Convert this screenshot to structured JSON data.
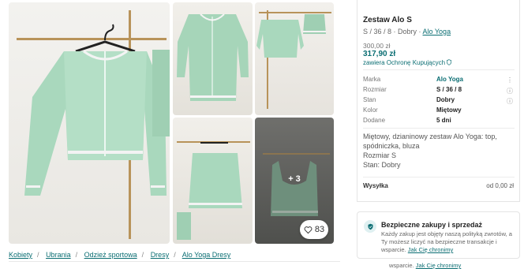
{
  "gallery": {
    "more_count": "+ 3",
    "likes": "83"
  },
  "breadcrumb": [
    "Kobiety",
    "Ubrania",
    "Odzież sportowa",
    "Dresy",
    "Alo Yoga Dresy"
  ],
  "listing": {
    "title": "Zestaw Alo S",
    "subtitle_prefix": "S / 36 / 8 · Dobry · ",
    "brand_link": "Alo Yoga",
    "price_old": "300,00 zł",
    "price_new": "317,90 zł",
    "protection": "zawiera Ochronę Kupujących"
  },
  "details": [
    {
      "key": "Marka",
      "value": "Alo Yoga",
      "link": true,
      "icon": "more-icon"
    },
    {
      "key": "Rozmiar",
      "value": "S / 36 / 8",
      "link": false,
      "icon": "info-icon"
    },
    {
      "key": "Stan",
      "value": "Dobry",
      "link": false,
      "icon": "info-icon"
    },
    {
      "key": "Kolor",
      "value": "Miętowy",
      "link": false,
      "icon": ""
    },
    {
      "key": "Dodane",
      "value": "5 dni",
      "link": false,
      "icon": ""
    }
  ],
  "description": {
    "line1": "Miętowy, dzianinowy zestaw Alo Yoga: top, spódniczka, bluza",
    "line2": "Rozmiar S",
    "line3": "Stan: Dobry"
  },
  "shipping": {
    "label": "Wysyłka",
    "value": "od 0,00 zł"
  },
  "safe": {
    "title": "Bezpieczne zakupy i sprzedaż",
    "text": "Każdy zakup jest objęty naszą polityką zwrotów, a Ty możesz liczyć na bezpieczne transakcje i wsparcie.",
    "link": "Jak Cię chronimy",
    "ghost_prefix": "wsparcie.",
    "ghost_link": "Jak Cię chronimy"
  },
  "colors": {
    "accent": "#0b6e73",
    "brand_green": "#2d8a52",
    "mint": "#a9d8bd"
  }
}
